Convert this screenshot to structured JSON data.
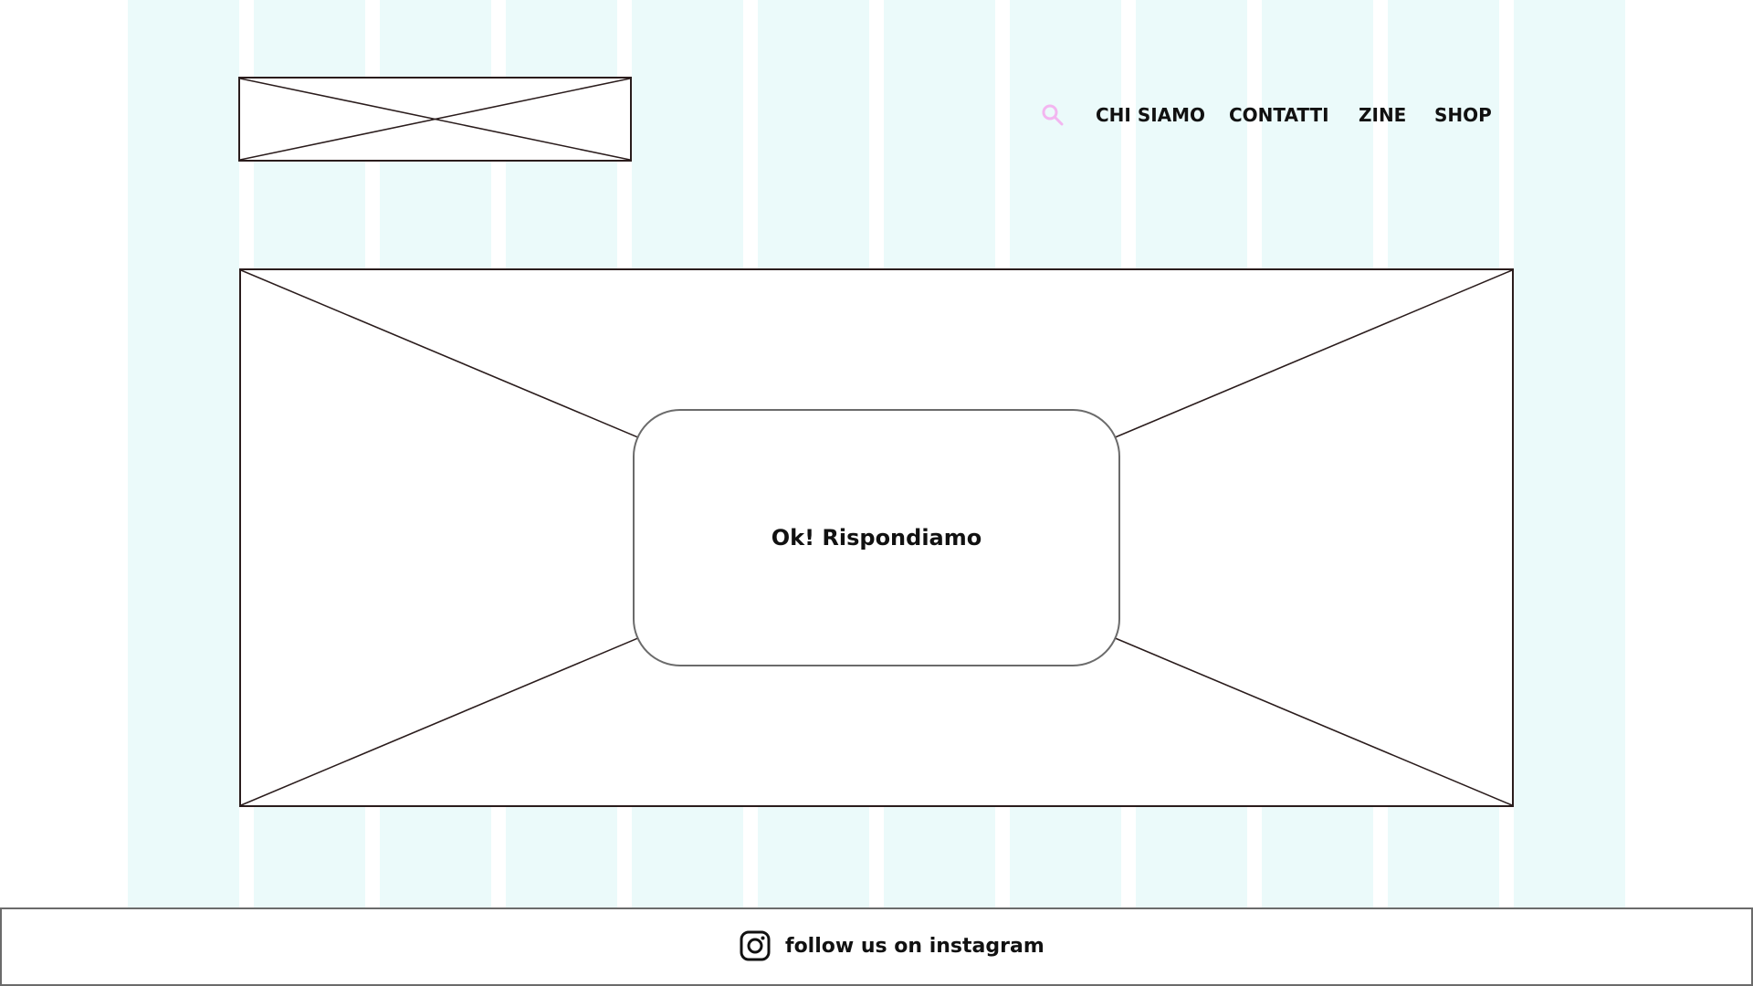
{
  "colors": {
    "grid_column": "#ebfafa",
    "placeholder_stroke": "#2a1c1c",
    "search_icon": "#f3b6f0",
    "text": "#111111",
    "border": "#6b6b6b"
  },
  "header": {
    "logo_icon": "image-placeholder-icon",
    "search_icon": "search-icon",
    "nav": [
      {
        "label": "CHI SIAMO"
      },
      {
        "label": "CONTATTI"
      },
      {
        "label": "ZINE"
      },
      {
        "label": "SHOP"
      }
    ]
  },
  "hero": {
    "image_icon": "image-placeholder-icon",
    "cta_label": "Ok! Rispondiamo"
  },
  "footer": {
    "instagram_icon": "instagram-icon",
    "instagram_label": "follow us on instagram"
  }
}
